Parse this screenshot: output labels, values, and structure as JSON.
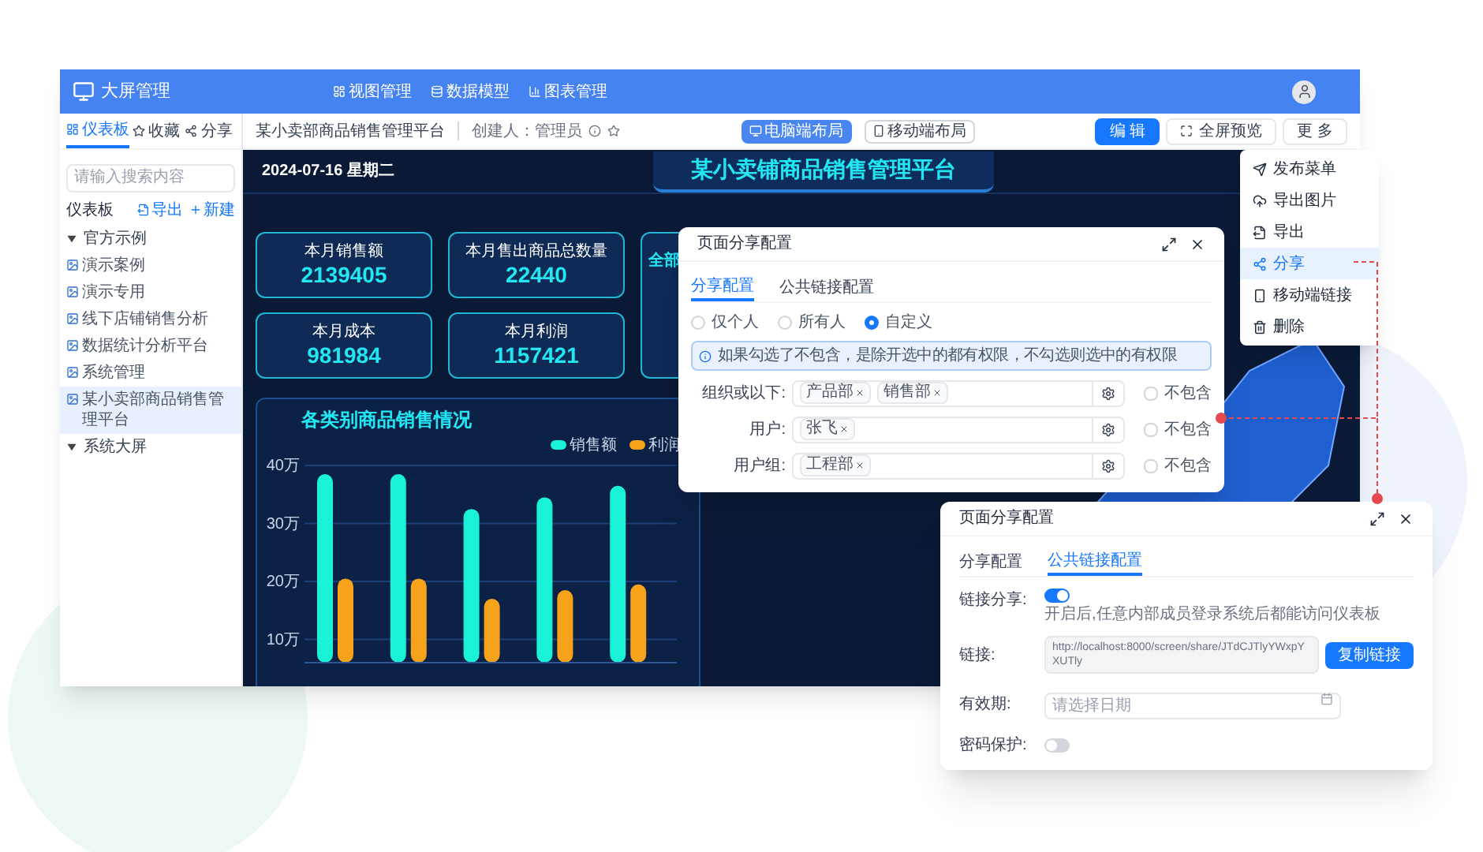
{
  "app": {
    "logo_text": "大屏管理",
    "nav": [
      {
        "label": "视图管理",
        "kind": "view"
      },
      {
        "label": "数据模型",
        "kind": "model"
      },
      {
        "label": "图表管理",
        "kind": "chart"
      }
    ]
  },
  "sidebar": {
    "tabs": [
      {
        "label": "仪表板",
        "selected": true,
        "kind": "board"
      },
      {
        "label": "收藏",
        "selected": false,
        "kind": "star"
      },
      {
        "label": "分享",
        "selected": false,
        "kind": "share"
      }
    ],
    "search": {
      "placeholder": "请输入搜索内容"
    },
    "heading": "仪表板",
    "actions": [
      {
        "label": "导出",
        "kind": "export"
      },
      {
        "label": "新建",
        "kind": "add"
      }
    ],
    "tree": [
      {
        "label": "官方示例",
        "expanded": true,
        "children": [
          {
            "label": "演示案例",
            "selected": false
          },
          {
            "label": "演示专用",
            "selected": false
          },
          {
            "label": "线下店铺销售分析",
            "selected": false
          },
          {
            "label": "数据统计分析平台",
            "selected": false
          },
          {
            "label": "系统管理",
            "selected": false
          },
          {
            "label": "某小卖部商品销售管理平台",
            "selected": true
          }
        ]
      },
      {
        "label": "系统大屏",
        "expanded": true
      }
    ]
  },
  "toolbar": {
    "title": "某小卖部商品销售管理平台",
    "creator": "创建人：管理员",
    "layouts": [
      {
        "label": "电脑端布局",
        "selected": true,
        "kind": "desktop"
      },
      {
        "label": "移动端布局",
        "selected": false,
        "kind": "mobile"
      }
    ],
    "buttons": [
      {
        "label": "编 辑",
        "kind": "primary"
      },
      {
        "label": "全屏预览",
        "kind": "fullscreen"
      },
      {
        "label": "更 多",
        "kind": "default"
      }
    ]
  },
  "dashboard": {
    "date": "2024-07-16 星期二",
    "title": "某小卖铺商品销售管理平台",
    "cards": [
      {
        "label": "本月销售额",
        "value": "2139405"
      },
      {
        "label": "本月售出商品总数量",
        "value": "22440"
      },
      {
        "label": "本月成本",
        "value": "981984"
      },
      {
        "label": "本月利润",
        "value": "1157421"
      }
    ],
    "side_card": {
      "title": "全部"
    },
    "chart": {
      "title": "各类别商品销售情况",
      "chart_data": {
        "type": "bar",
        "grid": true,
        "ylim": [
          6,
          40
        ],
        "yticks": [
          {
            "value": 10,
            "label": "10万"
          },
          {
            "value": 20,
            "label": "20万"
          },
          {
            "value": 30,
            "label": "30万"
          },
          {
            "value": 40,
            "label": "40万"
          }
        ],
        "series": [
          {
            "name": "销售额",
            "color": "#19f2d6",
            "values": [
              38.5,
              38.5,
              32.5,
              34.5,
              36.5
            ]
          },
          {
            "name": "利润",
            "color": "#f7a21b",
            "values": [
              20.5,
              20.5,
              17,
              18.5,
              19.5
            ]
          }
        ]
      }
    }
  },
  "more_menu": {
    "items": [
      {
        "label": "发布菜单",
        "selected": false,
        "kind": "publish"
      },
      {
        "label": "导出图片",
        "selected": false,
        "kind": "image"
      },
      {
        "label": "导出",
        "selected": false,
        "kind": "export"
      },
      {
        "label": "分享",
        "selected": true,
        "kind": "share"
      },
      {
        "label": "移动端链接",
        "selected": false,
        "kind": "mobile"
      },
      {
        "label": "删除",
        "selected": false,
        "kind": "delete"
      }
    ]
  },
  "share_dialog": {
    "title": "页面分享配置",
    "tabs": [
      {
        "label": "分享配置",
        "selected": true
      },
      {
        "label": "公共链接配置",
        "selected": false
      }
    ],
    "scopes": [
      {
        "label": "仅个人",
        "selected": false
      },
      {
        "label": "所有人",
        "selected": false
      },
      {
        "label": "自定义",
        "selected": true
      }
    ],
    "info": "如果勾选了不包含，是除开选中的都有权限，不勾选则选中的有权限",
    "rows": [
      {
        "label": "组织或以下:",
        "tags": [
          "产品部",
          "销售部"
        ],
        "exclude": {
          "label": "不包含",
          "checked": false
        }
      },
      {
        "label": "用户:",
        "tags": [
          "张飞"
        ],
        "exclude": {
          "label": "不包含",
          "checked": false
        }
      },
      {
        "label": "用户组:",
        "tags": [
          "工程部"
        ],
        "exclude": {
          "label": "不包含",
          "checked": false
        }
      }
    ]
  },
  "link_dialog": {
    "title": "页面分享配置",
    "tabs": [
      {
        "label": "分享配置",
        "selected": false
      },
      {
        "label": "公共链接配置",
        "selected": true
      }
    ],
    "link_share": {
      "label": "链接分享:",
      "on": true,
      "hint": "开启后,任意内部成员登录系统后都能访问仪表板"
    },
    "link": {
      "label": "链接:",
      "value": "http://localhost:8000/screen/share/JTdCJTlyYWxpYXUTly",
      "button": "复制链接"
    },
    "expiry": {
      "label": "有效期:",
      "placeholder": "请选择日期"
    },
    "password": {
      "label": "密码保护:",
      "on": false
    }
  }
}
